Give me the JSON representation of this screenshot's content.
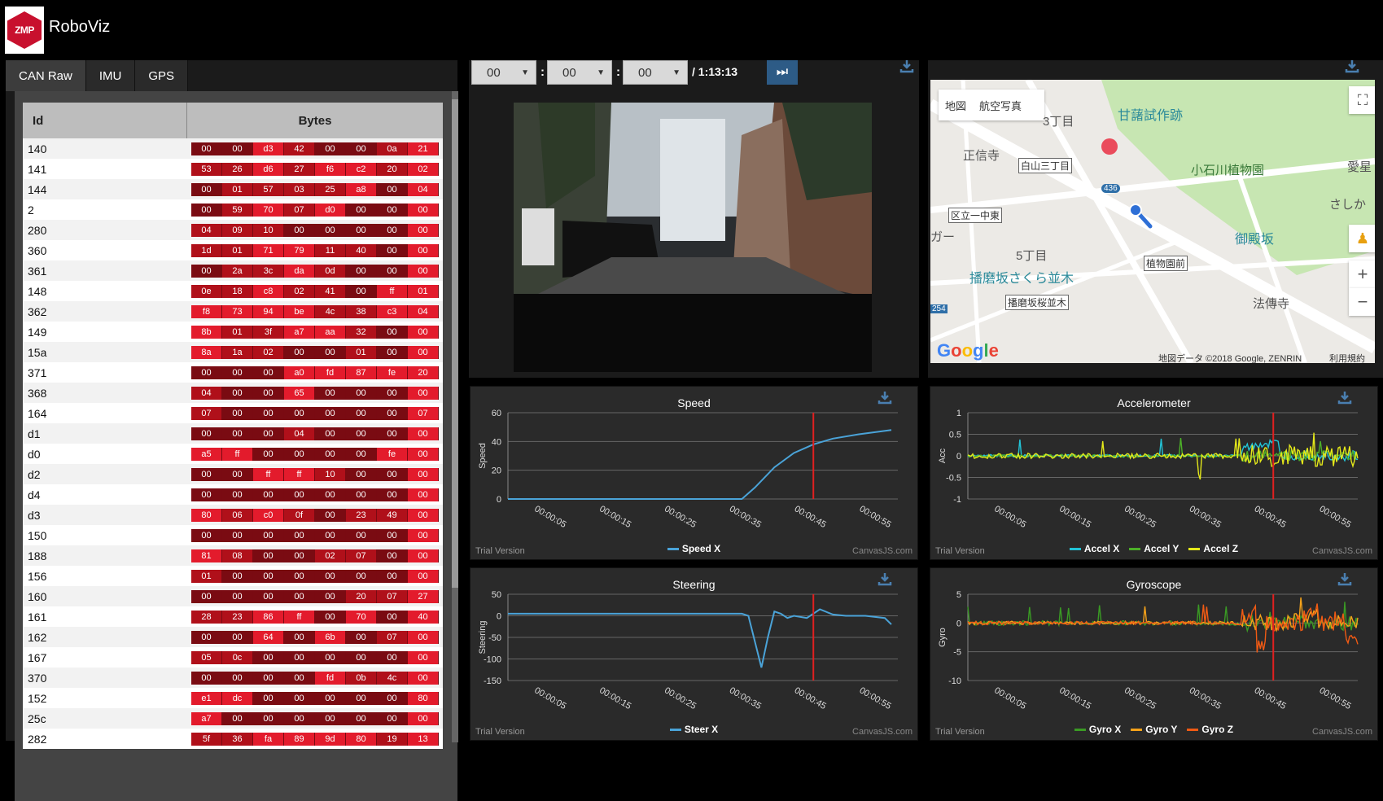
{
  "app": {
    "title": "RoboViz",
    "logo_text": "ZMP"
  },
  "can_panel": {
    "tabs": [
      {
        "label": "CAN Raw",
        "active": true
      },
      {
        "label": "IMU",
        "active": false
      },
      {
        "label": "GPS",
        "active": false
      }
    ],
    "columns": {
      "id": "Id",
      "bytes": "Bytes"
    },
    "rows": [
      {
        "id": "140",
        "bytes": [
          "00",
          "00",
          "d3",
          "42",
          "00",
          "00",
          "0a",
          "21"
        ]
      },
      {
        "id": "141",
        "bytes": [
          "53",
          "26",
          "d6",
          "27",
          "f6",
          "c2",
          "20",
          "02"
        ]
      },
      {
        "id": "144",
        "bytes": [
          "00",
          "01",
          "57",
          "03",
          "25",
          "a8",
          "00",
          "04"
        ]
      },
      {
        "id": "2",
        "bytes": [
          "00",
          "59",
          "70",
          "07",
          "d0",
          "00",
          "00",
          "00"
        ]
      },
      {
        "id": "280",
        "bytes": [
          "04",
          "09",
          "10",
          "00",
          "00",
          "00",
          "00",
          "00"
        ]
      },
      {
        "id": "360",
        "bytes": [
          "1d",
          "01",
          "71",
          "79",
          "11",
          "40",
          "00",
          "00"
        ]
      },
      {
        "id": "361",
        "bytes": [
          "00",
          "2a",
          "3c",
          "da",
          "0d",
          "00",
          "00",
          "00"
        ]
      },
      {
        "id": "148",
        "bytes": [
          "0e",
          "18",
          "c8",
          "02",
          "41",
          "00",
          "ff",
          "01"
        ]
      },
      {
        "id": "362",
        "bytes": [
          "f8",
          "73",
          "94",
          "be",
          "4c",
          "38",
          "c3",
          "04"
        ]
      },
      {
        "id": "149",
        "bytes": [
          "8b",
          "01",
          "3f",
          "a7",
          "aa",
          "32",
          "00",
          "00"
        ]
      },
      {
        "id": "15a",
        "bytes": [
          "8a",
          "1a",
          "02",
          "00",
          "00",
          "01",
          "00",
          "00"
        ]
      },
      {
        "id": "371",
        "bytes": [
          "00",
          "00",
          "00",
          "a0",
          "fd",
          "87",
          "fe",
          "20"
        ]
      },
      {
        "id": "368",
        "bytes": [
          "04",
          "00",
          "00",
          "65",
          "00",
          "00",
          "00",
          "00"
        ]
      },
      {
        "id": "164",
        "bytes": [
          "07",
          "00",
          "00",
          "00",
          "00",
          "00",
          "00",
          "07"
        ]
      },
      {
        "id": "d1",
        "bytes": [
          "00",
          "00",
          "00",
          "04",
          "00",
          "00",
          "00",
          "00"
        ]
      },
      {
        "id": "d0",
        "bytes": [
          "a5",
          "ff",
          "00",
          "00",
          "00",
          "00",
          "fe",
          "00"
        ]
      },
      {
        "id": "d2",
        "bytes": [
          "00",
          "00",
          "ff",
          "ff",
          "10",
          "00",
          "00",
          "00"
        ]
      },
      {
        "id": "d4",
        "bytes": [
          "00",
          "00",
          "00",
          "00",
          "00",
          "00",
          "00",
          "00"
        ]
      },
      {
        "id": "d3",
        "bytes": [
          "80",
          "06",
          "c0",
          "0f",
          "00",
          "23",
          "49",
          "00"
        ]
      },
      {
        "id": "150",
        "bytes": [
          "00",
          "00",
          "00",
          "00",
          "00",
          "00",
          "00",
          "00"
        ]
      },
      {
        "id": "188",
        "bytes": [
          "81",
          "08",
          "00",
          "00",
          "02",
          "07",
          "00",
          "00"
        ]
      },
      {
        "id": "156",
        "bytes": [
          "01",
          "00",
          "00",
          "00",
          "00",
          "00",
          "00",
          "00"
        ]
      },
      {
        "id": "160",
        "bytes": [
          "00",
          "00",
          "00",
          "00",
          "00",
          "20",
          "07",
          "27"
        ]
      },
      {
        "id": "161",
        "bytes": [
          "28",
          "23",
          "86",
          "ff",
          "00",
          "70",
          "00",
          "40"
        ]
      },
      {
        "id": "162",
        "bytes": [
          "00",
          "00",
          "64",
          "00",
          "6b",
          "00",
          "07",
          "00"
        ]
      },
      {
        "id": "167",
        "bytes": [
          "05",
          "0c",
          "00",
          "00",
          "00",
          "00",
          "00",
          "00"
        ]
      },
      {
        "id": "370",
        "bytes": [
          "00",
          "00",
          "00",
          "00",
          "fd",
          "0b",
          "4c",
          "00"
        ]
      },
      {
        "id": "152",
        "bytes": [
          "e1",
          "dc",
          "00",
          "00",
          "00",
          "00",
          "00",
          "80"
        ]
      },
      {
        "id": "25c",
        "bytes": [
          "a7",
          "00",
          "00",
          "00",
          "00",
          "00",
          "00",
          "00"
        ]
      },
      {
        "id": "282",
        "bytes": [
          "5f",
          "36",
          "fa",
          "89",
          "9d",
          "80",
          "19",
          "13"
        ]
      }
    ]
  },
  "video_panel": {
    "hours": "00",
    "minutes": "00",
    "seconds": "00",
    "duration": "/ 1:13:13"
  },
  "map_panel": {
    "map_button": "地図",
    "satellite_button": "航空写真",
    "labels": [
      "3丁目",
      "正信寺",
      "白山三丁目",
      "区立一中東",
      "ガー",
      "5丁目",
      "播磨坂さくら並木",
      "播磨坂桜並木",
      "植物園前",
      "小石川植物園",
      "甘藷試作跡",
      "御殿坂",
      "法傳寺",
      "愛星",
      "さしか",
      "436",
      "254"
    ],
    "google": "Google",
    "copyright": "地図データ ©2018 Google, ZENRIN",
    "terms": "利用規約",
    "zoom_in": "+",
    "zoom_out": "−"
  },
  "chart_data": [
    {
      "type": "line",
      "title": "Speed",
      "ylabel": "Speed",
      "x_ticks": [
        "00:00:05",
        "00:00:15",
        "00:00:25",
        "00:00:35",
        "00:00:45",
        "00:00:55"
      ],
      "y_ticks": [
        0,
        20,
        40,
        60
      ],
      "ylim": [
        0,
        60
      ],
      "xlim": [
        0,
        60
      ],
      "series": [
        {
          "name": "Speed X",
          "color": "#4aa3d8",
          "x": [
            0,
            36,
            38,
            41,
            44,
            47,
            50,
            54,
            59
          ],
          "y": [
            0,
            0,
            8,
            22,
            32,
            38,
            42,
            45,
            48
          ]
        }
      ],
      "cursor_x": 47
    },
    {
      "type": "line",
      "title": "Accelerometer",
      "ylabel": "Acc",
      "x_ticks": [
        "00:00:05",
        "00:00:15",
        "00:00:25",
        "00:00:35",
        "00:00:45",
        "00:00:55"
      ],
      "y_ticks": [
        1,
        0.5,
        0,
        -0.5,
        -1
      ],
      "ylim": [
        -1,
        1
      ],
      "xlim": [
        0,
        60
      ],
      "series": [
        {
          "name": "Accel X",
          "color": "#22c3d6"
        },
        {
          "name": "Accel Y",
          "color": "#4caf28"
        },
        {
          "name": "Accel Z",
          "color": "#e4e81a"
        }
      ],
      "cursor_x": 47
    },
    {
      "type": "line",
      "title": "Steering",
      "ylabel": "Steering",
      "x_ticks": [
        "00:00:05",
        "00:00:15",
        "00:00:25",
        "00:00:35",
        "00:00:45",
        "00:00:55"
      ],
      "y_ticks": [
        50,
        0,
        -50,
        -100,
        -150
      ],
      "ylim": [
        -150,
        50
      ],
      "xlim": [
        0,
        60
      ],
      "series": [
        {
          "name": "Steer X",
          "color": "#4aa3d8",
          "x": [
            0,
            36,
            37,
            38,
            39,
            40,
            41,
            42,
            43,
            44,
            46,
            48,
            50,
            52,
            55,
            58,
            59
          ],
          "y": [
            5,
            5,
            0,
            -60,
            -120,
            -50,
            10,
            5,
            -5,
            0,
            -5,
            15,
            3,
            0,
            0,
            -5,
            -20
          ]
        }
      ],
      "cursor_x": 47
    },
    {
      "type": "line",
      "title": "Gyroscope",
      "ylabel": "Gyro",
      "x_ticks": [
        "00:00:05",
        "00:00:15",
        "00:00:25",
        "00:00:35",
        "00:00:45",
        "00:00:55"
      ],
      "y_ticks": [
        5,
        0,
        -5,
        -10
      ],
      "ylim": [
        -10,
        5
      ],
      "xlim": [
        0,
        60
      ],
      "series": [
        {
          "name": "Gyro X",
          "color": "#3a9a24"
        },
        {
          "name": "Gyro Y",
          "color": "#f5a21a"
        },
        {
          "name": "Gyro Z",
          "color": "#f05a14"
        }
      ],
      "cursor_x": 47
    }
  ],
  "chart_footer": {
    "trial": "Trial Version",
    "brand": "CanvasJS.com"
  }
}
